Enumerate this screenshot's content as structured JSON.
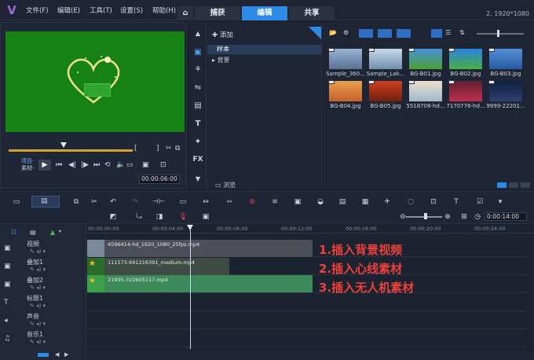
{
  "app": {
    "logo": "V",
    "resolution": "2, 1920*1080"
  },
  "menu": [
    "文件(F)",
    "编辑(E)",
    "工具(T)",
    "设置(S)",
    "帮助(H)"
  ],
  "tabs": {
    "home_icon": "home-icon",
    "capture": "捕获",
    "edit": "编辑",
    "share": "共享"
  },
  "preview": {
    "mode_project": "项目-",
    "mode_clip": "素材-",
    "timecode": "00:00:06:00",
    "video_color": "#168216"
  },
  "library": {
    "add_label": "添加",
    "tree": [
      "样本",
      "背景"
    ],
    "browse_label": "浏览",
    "thumbnails": [
      {
        "label": "Sample_360...",
        "colors": [
          "#9ab4d8",
          "#5a7090"
        ]
      },
      {
        "label": "Sample_Lak...",
        "colors": [
          "#c8d8ea",
          "#7090b0"
        ]
      },
      {
        "label": "BG-B01.jpg",
        "colors": [
          "#4a90e0",
          "#4ca030"
        ]
      },
      {
        "label": "BG-B02.jpg",
        "colors": [
          "#2a80e0",
          "#48b040"
        ]
      },
      {
        "label": "BG-B03.jpg",
        "colors": [
          "#5090d8",
          "#2a5aa0"
        ]
      },
      {
        "label": "BG-B04.jpg",
        "colors": [
          "#e8a050",
          "#c8602a"
        ]
      },
      {
        "label": "BG-B05.jpg",
        "colors": [
          "#d04020",
          "#702010"
        ]
      },
      {
        "label": "5518708-hd...",
        "colors": [
          "#e8e0c8",
          "#a0b8d0"
        ]
      },
      {
        "label": "7170776-hd...",
        "colors": [
          "#602030",
          "#c03050"
        ]
      },
      {
        "label": "9999-22201...",
        "colors": [
          "#102040",
          "#2a4070"
        ]
      }
    ]
  },
  "timeline": {
    "clock": "0:00:14:00",
    "ruler": [
      "00:00:00:00",
      "00:00:04:00",
      "00:00:08:00",
      "00:00:12:00",
      "00:00:16:00",
      "00:00:20:00",
      "00:00:24:00"
    ],
    "tracks": [
      "视频",
      "叠加1",
      "叠加2",
      "标题1",
      "声音",
      "音乐1"
    ],
    "clips": [
      {
        "name": "4596414-hd_1920_1080_25fps.mp4"
      },
      {
        "name": "111573-691216391_medium.mp4"
      },
      {
        "name": "21905-322605117.mp4"
      }
    ]
  },
  "annotations": [
    "1.插入背景视频",
    "2.插入心线素材",
    "3.插入无人机素材"
  ]
}
